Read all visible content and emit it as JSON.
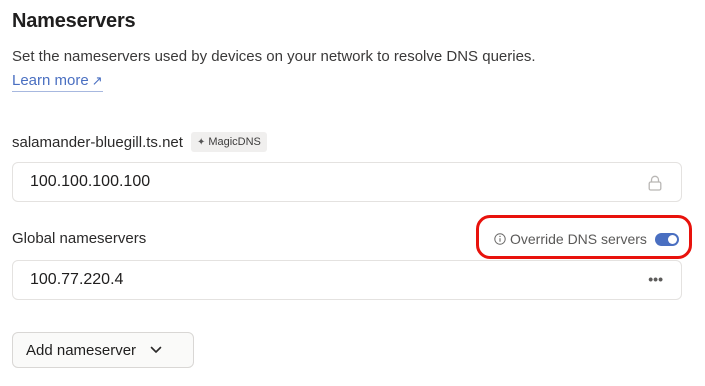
{
  "section": {
    "title": "Nameservers",
    "description": "Set the nameservers used by devices on your network to resolve DNS queries.",
    "learn_more": "Learn more",
    "learn_more_arrow": "↗"
  },
  "tailnet": {
    "name": "salamander-bluegill.ts.net",
    "badge_icon": "sparkle-icon",
    "badge_label": "MagicDNS",
    "nameserver": "100.100.100.100",
    "icon": "lock-icon"
  },
  "global": {
    "label": "Global nameservers",
    "override_label": "Override DNS servers",
    "override_enabled": true,
    "nameservers": [
      "100.77.220.4"
    ],
    "row_menu_icon": "more-horizontal-icon"
  },
  "actions": {
    "add_label": "Add nameserver",
    "add_icon": "chevron-down-icon"
  },
  "colors": {
    "accent": "#4a6fc1",
    "highlight": "#e8120c"
  }
}
